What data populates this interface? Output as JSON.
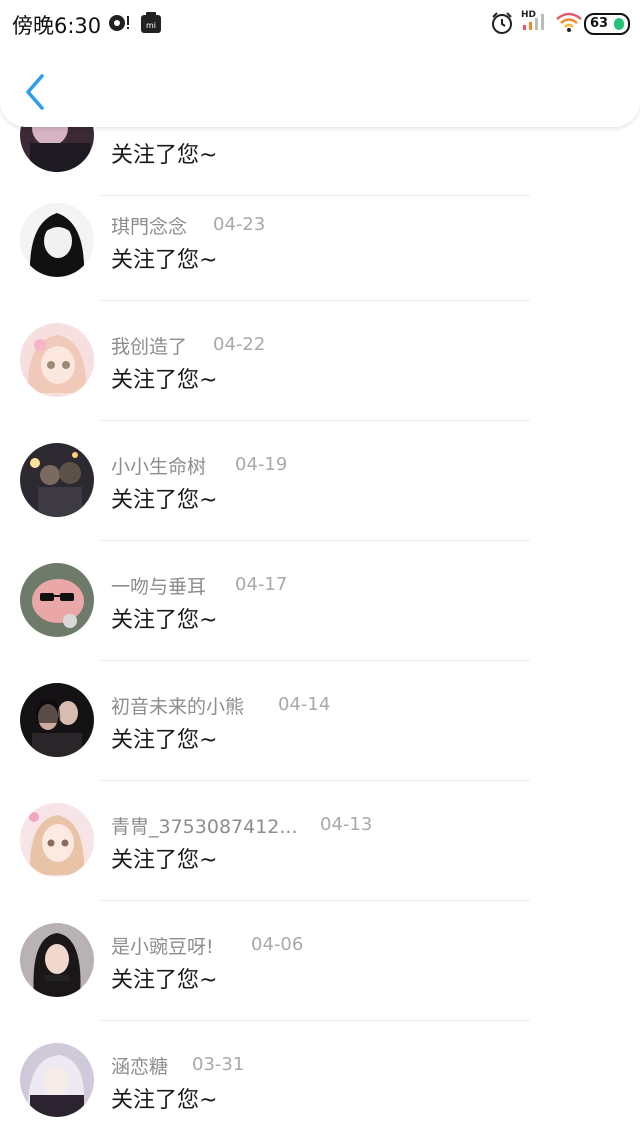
{
  "status_bar": {
    "time": "傍晚6:30",
    "battery": "63",
    "network": "HD",
    "icons": [
      "media-icon",
      "mi-app-icon",
      "alarm-icon",
      "signal-icon",
      "wifi-icon",
      "battery-icon"
    ]
  },
  "header": {
    "back_icon": "chevron-left-icon"
  },
  "colors": {
    "accent": "#2a9ff0",
    "name": "#8d8d8d",
    "date": "#a9a9a9",
    "message": "#1a1a1a",
    "battery_green": "#27c27a"
  },
  "notifications": [
    {
      "name": "",
      "date": "",
      "message": "关注了您~"
    },
    {
      "name": "琪門念念",
      "date": "04-23",
      "message": "关注了您~"
    },
    {
      "name": "我创造了",
      "date": "04-22",
      "message": "关注了您~"
    },
    {
      "name": "小小生命树",
      "date": "04-19",
      "message": "关注了您~"
    },
    {
      "name": "一吻与垂耳",
      "date": "04-17",
      "message": "关注了您~"
    },
    {
      "name": "初音未来的小熊",
      "date": "04-14",
      "message": "关注了您~"
    },
    {
      "name": "青冑_3753087412...",
      "date": "04-13",
      "message": "关注了您~"
    },
    {
      "name": "是小豌豆呀!",
      "date": "04-06",
      "message": "关注了您~"
    },
    {
      "name": "涵恋糖",
      "date": "03-31",
      "message": "关注了您~"
    }
  ]
}
